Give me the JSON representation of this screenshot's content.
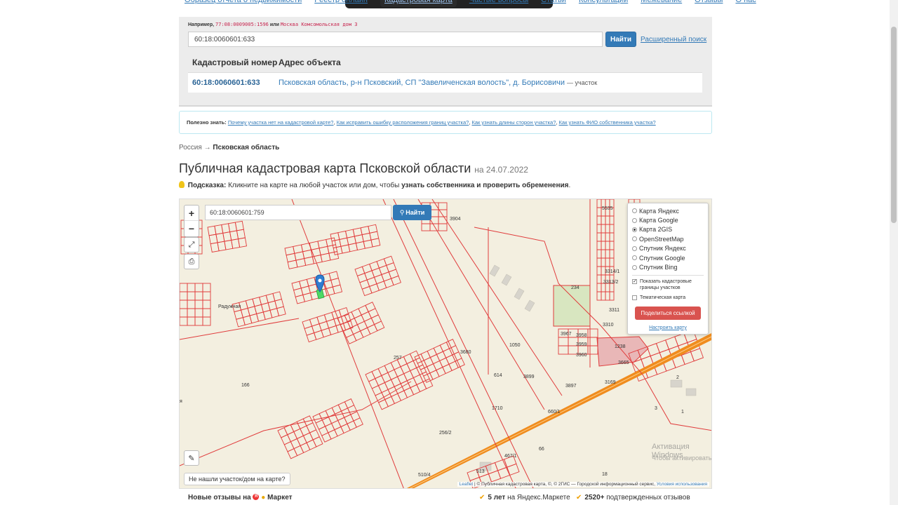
{
  "nav": {
    "items": [
      "Образец отчета о недвижимости",
      "Реестр онлайн",
      "Кадастровая карта",
      "Частые вопросы",
      "Статьи",
      "Консультации",
      "Межевание",
      "Отзывы",
      "О нас"
    ]
  },
  "search": {
    "example_label": "Например,",
    "example_code": "77:08:0009005:1596",
    "example_or": "или",
    "example_address": "Москва Комсомольская дом 3",
    "value": "60:18:0060601:633",
    "find_label": "Найти",
    "advanced_label": "Расширенный поиск"
  },
  "results": {
    "col_number": "Кадастровый номер",
    "col_address": "Адрес объекта",
    "rows": [
      {
        "number": "60:18:0060601:633",
        "address": "Псковская область, р-н Псковский, СП \"Завеличенская волость\", д. Борисовичи",
        "type": "— участок"
      }
    ]
  },
  "useful": {
    "label": "Полезно знать:",
    "links": [
      "Почему участка нет на кадастровой карте?",
      "Как исправить ошибку расположения границ участка?",
      "Как узнать длины сторон участка?",
      "Как узнать ФИО собственника участка?"
    ]
  },
  "breadcrumb": {
    "root": "Россия",
    "sep": "→",
    "current": "Псковская область"
  },
  "title": {
    "text": "Публичная кадастровая карта Псковской области",
    "date": "на 24.07.2022"
  },
  "hint": {
    "label": "Подсказка:",
    "text": "Кликните на карте на любой участок или дом, чтобы",
    "bold": "узнать собственника и проверить обременения",
    "end": "."
  },
  "map": {
    "search_value": "60:18:0060601:759",
    "find_label": "Найти",
    "zoom_in": "+",
    "zoom_out": "−",
    "layers": [
      "Карта Яндекс",
      "Карта Google",
      "Карта 2GIS",
      "OpenStreetMap",
      "Спутник Яндекс",
      "Спутник Google",
      "Спутник Bing"
    ],
    "selected_layer": "Карта 2GIS",
    "show_borders_label": "Показать кадастровые границы участков",
    "thematic_label": "Тематическая карта",
    "share_label": "Поделиться ссылкой",
    "configure_label": "Настроить карту",
    "not_found_label": "Не нашли участок/дом на карте?",
    "attribution": {
      "leaflet": "Leaflet",
      "text": "| © Публичная кадастровая карта, ©, © 2ГИС — Городской информационный сервис,",
      "terms": "Условия использования"
    },
    "watermark_line1": "Активация Windows",
    "watermark_line2": "Чтобы активировать Windows, перейдите в раздел \"Параметры\".",
    "labels": [
      "234",
      "1050",
      "257",
      "166",
      "614",
      "3899",
      "256/2",
      "66",
      "18",
      "1238",
      "3310",
      "5535",
      "3958",
      "3959",
      "3960",
      "3967",
      "3904",
      "1710",
      "3680",
      "3665",
      "3169",
      "3897",
      "3313/2",
      "3314/1",
      "3311",
      "513",
      "467/1",
      "510/4",
      "660/1",
      "Радужная",
      "я",
      "3",
      "2",
      "1"
    ],
    "accent_road": "#f08c1e",
    "parcel_line": "#e03c3c"
  },
  "reviews": {
    "left_prefix": "Новые отзывы на",
    "left_market": "Маркет",
    "stat1_bold": "5 лет",
    "stat1_rest": "на Яндекс.Маркете",
    "stat2_bold": "2520+",
    "stat2_rest": "подтвержденных отзывов"
  }
}
